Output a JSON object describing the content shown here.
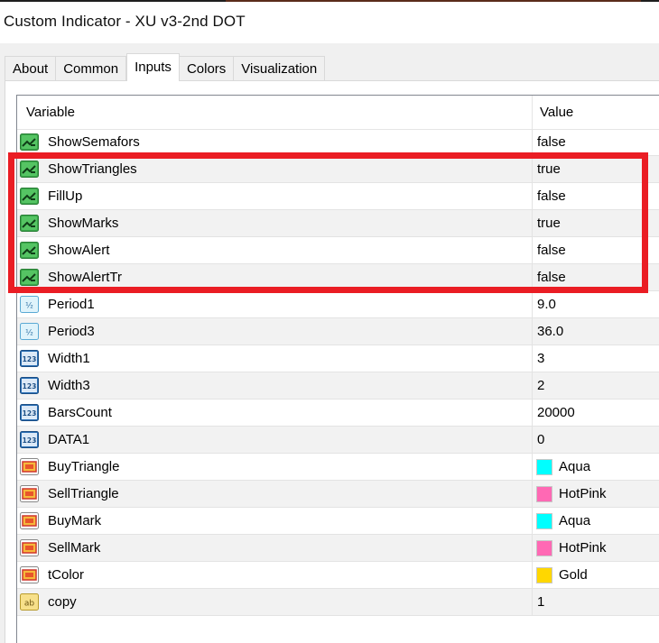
{
  "window": {
    "title": "Custom Indicator - XU v3-2nd DOT"
  },
  "tabs": [
    {
      "label": "About",
      "active": false
    },
    {
      "label": "Common",
      "active": false
    },
    {
      "label": "Inputs",
      "active": true
    },
    {
      "label": "Colors",
      "active": false
    },
    {
      "label": "Visualization",
      "active": false
    }
  ],
  "grid": {
    "headers": {
      "variable": "Variable",
      "value": "Value"
    },
    "rows": [
      {
        "name": "ShowSemafors",
        "value": "false",
        "icon": "bool-icon"
      },
      {
        "name": "ShowTriangles",
        "value": "true",
        "icon": "bool-icon"
      },
      {
        "name": "FillUp",
        "value": "false",
        "icon": "bool-icon"
      },
      {
        "name": "ShowMarks",
        "value": "true",
        "icon": "bool-icon"
      },
      {
        "name": "ShowAlert",
        "value": "false",
        "icon": "bool-icon"
      },
      {
        "name": "ShowAlertTr",
        "value": "false",
        "icon": "bool-icon"
      },
      {
        "name": "Period1",
        "value": "9.0",
        "icon": "double-icon"
      },
      {
        "name": "Period3",
        "value": "36.0",
        "icon": "double-icon"
      },
      {
        "name": "Width1",
        "value": "3",
        "icon": "integer-icon"
      },
      {
        "name": "Width3",
        "value": "2",
        "icon": "integer-icon"
      },
      {
        "name": "BarsCount",
        "value": "20000",
        "icon": "integer-icon"
      },
      {
        "name": "DATA1",
        "value": "0",
        "icon": "integer-icon"
      },
      {
        "name": "BuyTriangle",
        "value": "Aqua",
        "icon": "color-icon",
        "swatch": "#00ffff"
      },
      {
        "name": "SellTriangle",
        "value": "HotPink",
        "icon": "color-icon",
        "swatch": "#ff69b4"
      },
      {
        "name": "BuyMark",
        "value": "Aqua",
        "icon": "color-icon",
        "swatch": "#00ffff"
      },
      {
        "name": "SellMark",
        "value": "HotPink",
        "icon": "color-icon",
        "swatch": "#ff69b4"
      },
      {
        "name": "tColor",
        "value": "Gold",
        "icon": "color-icon",
        "swatch": "#ffd700"
      },
      {
        "name": "copy",
        "value": "1",
        "icon": "string-icon"
      }
    ]
  },
  "highlight": {
    "color": "#ea1d24"
  }
}
